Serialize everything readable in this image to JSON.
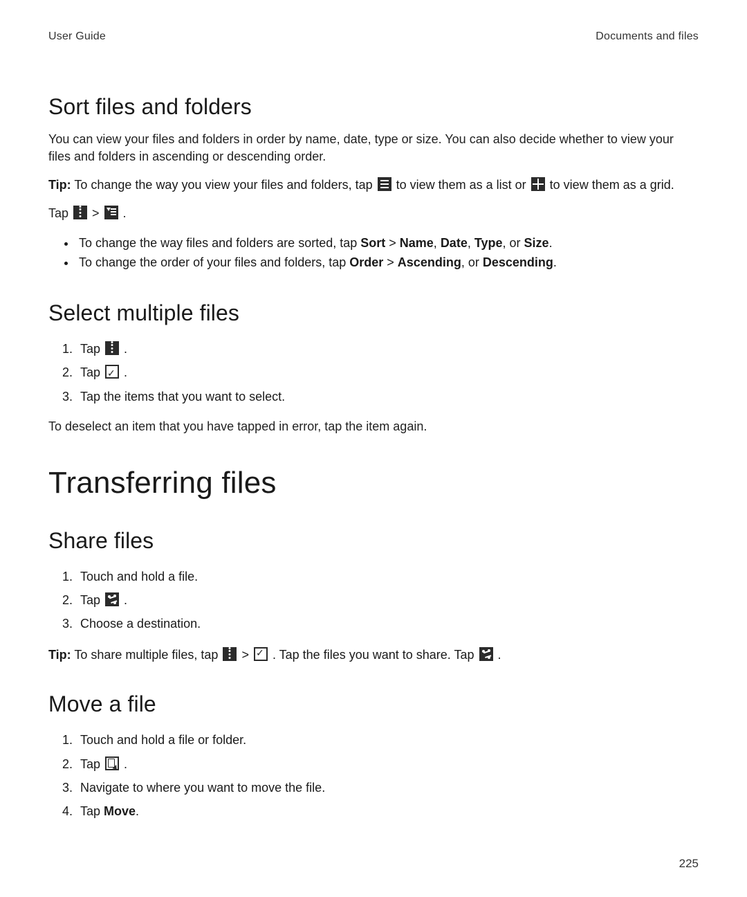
{
  "runhead": {
    "left": "User Guide",
    "right": "Documents and files"
  },
  "page_number": "225",
  "sort": {
    "heading": "Sort files and folders",
    "intro": "You can view your files and folders in order by name, date, type or size. You can also decide whether to view your files and folders in ascending or descending order.",
    "tip_label": "Tip:",
    "tip_before_listicon": " To change the way you view your files and folders, tap ",
    "tip_between": " to view them as a list or ",
    "tip_after_gridicon": " to view them as a grid.",
    "tap_line_prefix": "Tap ",
    "tap_line_sep": " > ",
    "tap_line_suffix": " .",
    "bullet1_pre": "To change the way files and folders are sorted, tap ",
    "bullet1_sort": "Sort",
    "bullet1_gt": " > ",
    "bullet1_name": "Name",
    "bullet1_c1": ", ",
    "bullet1_date": "Date",
    "bullet1_c2": ", ",
    "bullet1_type": "Type",
    "bullet1_c3": ", or ",
    "bullet1_size": "Size",
    "bullet1_end": ".",
    "bullet2_pre": "To change the order of your files and folders, tap ",
    "bullet2_order": "Order",
    "bullet2_gt": " > ",
    "bullet2_asc": "Ascending",
    "bullet2_c1": ", or ",
    "bullet2_desc": "Descending",
    "bullet2_end": "."
  },
  "select": {
    "heading": "Select multiple files",
    "step1_pre": "Tap ",
    "step1_suffix": " .",
    "step2_pre": "Tap ",
    "step2_suffix": " .",
    "step3": "Tap the items that you want to select.",
    "note": "To deselect an item that you have tapped in error, tap the item again."
  },
  "transfer": {
    "heading": "Transferring files"
  },
  "share": {
    "heading": "Share files",
    "step1": "Touch and hold a file.",
    "step2_pre": "Tap ",
    "step2_suffix": " .",
    "step3": "Choose a destination.",
    "tip_label": "Tip:",
    "tip_pre": " To share multiple files, tap ",
    "tip_sep": " > ",
    "tip_mid": " . Tap the files you want to share. Tap ",
    "tip_end": " ."
  },
  "move": {
    "heading": "Move a file",
    "step1": "Touch and hold a file or folder.",
    "step2_pre": "Tap ",
    "step2_suffix": " .",
    "step3": "Navigate to where you want to move the file.",
    "step4_pre": "Tap ",
    "step4_move": "Move",
    "step4_end": "."
  }
}
